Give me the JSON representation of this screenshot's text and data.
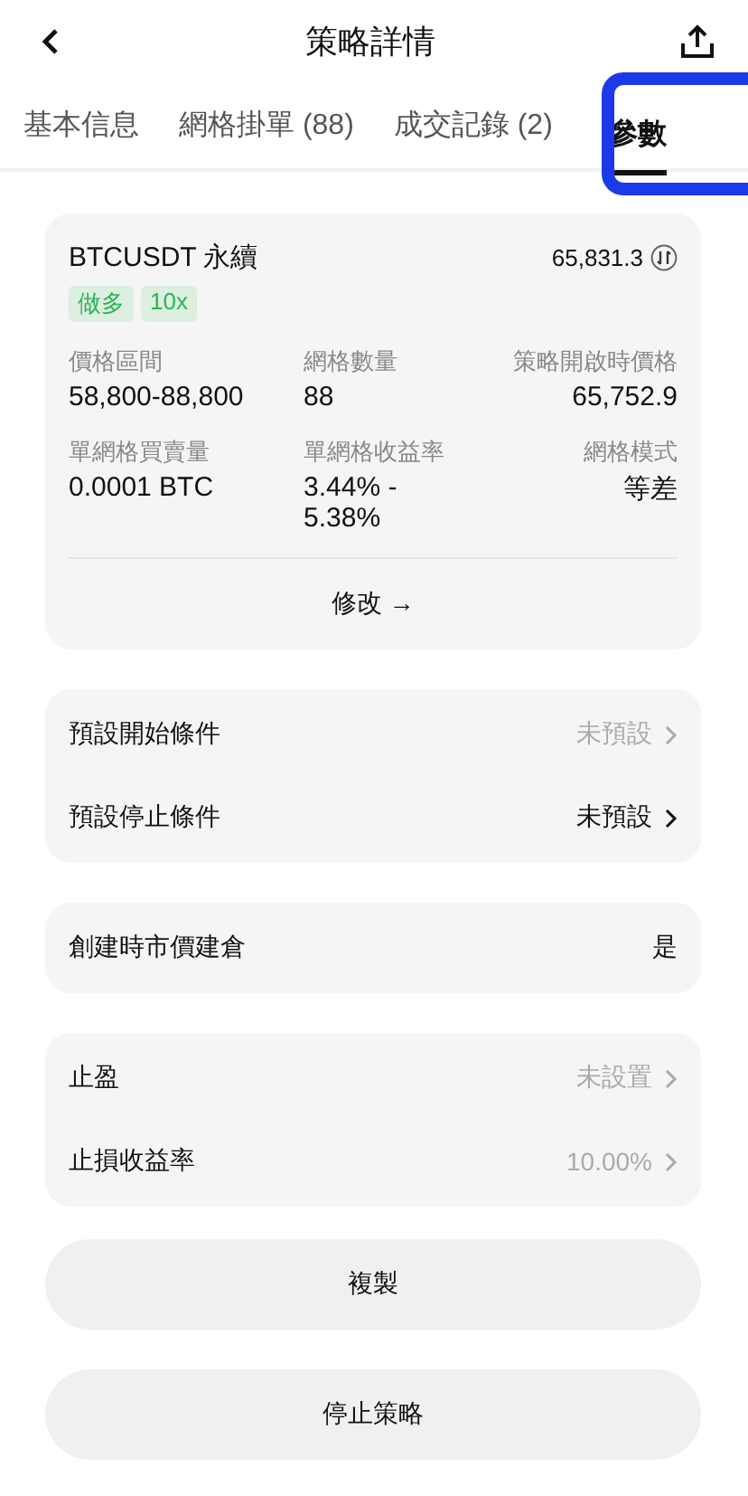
{
  "header": {
    "title": "策略詳情"
  },
  "tabs": [
    {
      "label": "基本信息",
      "selected": false
    },
    {
      "label": "網格掛單 (88)",
      "selected": false
    },
    {
      "label": "成交記錄 (2)",
      "selected": false
    },
    {
      "label": "參數",
      "selected": true
    }
  ],
  "summary": {
    "symbol": "BTCUSDT 永續",
    "price": "65,831.3",
    "tags": [
      "做多",
      "10x"
    ],
    "fields": [
      {
        "label": "價格區間",
        "value": "58,800-88,800"
      },
      {
        "label": "網格數量",
        "value": "88"
      },
      {
        "label": "策略開啟時價格",
        "value": "65,752.9"
      },
      {
        "label": "單網格買賣量",
        "value": "0.0001 BTC"
      },
      {
        "label": "單網格收益率",
        "value": "3.44% - 5.38%"
      },
      {
        "label": "網格模式",
        "value": "等差"
      }
    ],
    "edit": "修改 →"
  },
  "groups": [
    [
      {
        "label": "預設開始條件",
        "value": "未預設",
        "dim": true,
        "chevron": true
      },
      {
        "label": "預設停止條件",
        "value": "未預設",
        "dim": false,
        "chevron": true
      }
    ],
    [
      {
        "label": "創建時市價建倉",
        "value": "是",
        "dim": false,
        "chevron": false
      }
    ],
    [
      {
        "label": "止盈",
        "value": "未設置",
        "dim": true,
        "chevron": true
      },
      {
        "label": "止損收益率",
        "value": "10.00%",
        "dim": true,
        "chevron": true
      }
    ]
  ],
  "buttons": [
    "複製",
    "停止策略"
  ]
}
